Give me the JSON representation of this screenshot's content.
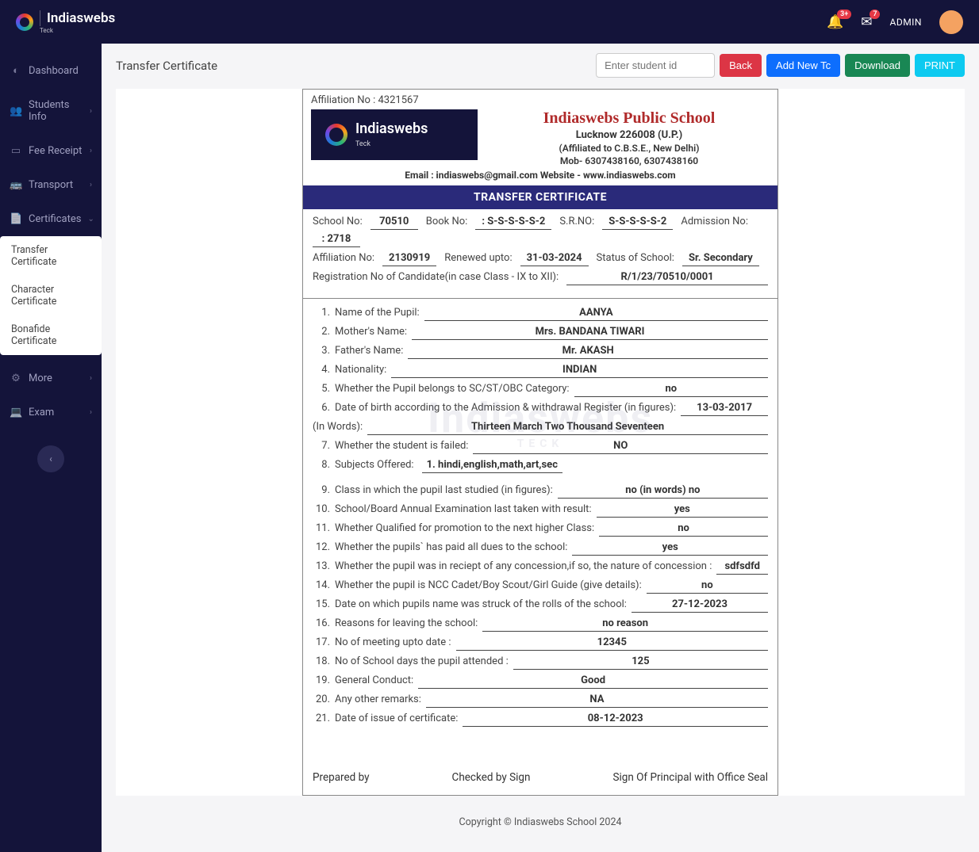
{
  "brand": {
    "name": "Indiaswebs",
    "sub": "Teck"
  },
  "topbar": {
    "notif_badge": "3+",
    "mail_badge": "7",
    "user": "ADMIN"
  },
  "sidebar": {
    "items": [
      {
        "label": "Dashboard",
        "icon": "◐"
      },
      {
        "label": "Students Info",
        "icon": "👥",
        "expand": true
      },
      {
        "label": "Fee Receipt",
        "icon": "▭",
        "expand": true
      },
      {
        "label": "Transport",
        "icon": "🚌",
        "expand": true
      },
      {
        "label": "Certificates",
        "icon": "📄",
        "expand": true
      },
      {
        "label": "More",
        "icon": "⚙",
        "expand": true
      },
      {
        "label": "Exam",
        "icon": "💻",
        "expand": true
      }
    ],
    "submenu": [
      "Transfer Certificate",
      "Character Certificate",
      "Bonafide Certificate"
    ]
  },
  "page": {
    "title": "Transfer Certificate",
    "search_placeholder": "Enter student id",
    "buttons": {
      "back": "Back",
      "add": "Add New Tc",
      "download": "Download",
      "print": "PRINT"
    }
  },
  "cert": {
    "affiliation_top": "Affiliation No : 4321567",
    "school_name": "Indiaswebs Public School",
    "school_sub": "Lucknow 226008 (U.P.)",
    "affiliated": "(Affiliated to C.B.S.E., New Delhi)",
    "mob": "Mob- 6307438160, 6307438160",
    "contact": "Email : indiaswebs@gmail.com Website - www.indiaswebs.com",
    "banner": "TRANSFER CERTIFICATE",
    "meta": {
      "school_no_l": "School No:",
      "school_no": "70510",
      "book_no_l": "Book No:",
      "book_no": ": S-S-S-S-S-2",
      "srno_l": "S.R.NO:",
      "srno": "S-S-S-S-S-2",
      "adm_l": "Admission No:",
      "adm": ": 2718",
      "aff_l": "Affiliation No:",
      "aff": "2130919",
      "renew_l": "Renewed upto:",
      "renew": "31-03-2024",
      "status_l": "Status of School:",
      "status": "Sr. Secondary",
      "reg_l": "Registration No of Candidate(in case Class - IX to XII):",
      "reg": "R/1/23/70510/0001"
    },
    "fields": [
      {
        "n": "1.",
        "l": "Name of the Pupil:",
        "v": "AANYA"
      },
      {
        "n": "2.",
        "l": "Mother's Name:",
        "v": "Mrs. BANDANA TIWARI"
      },
      {
        "n": "3.",
        "l": "Father's Name:",
        "v": "Mr. AKASH"
      },
      {
        "n": "4.",
        "l": "Nationality:",
        "v": "INDIAN"
      },
      {
        "n": "5.",
        "l": "Whether the Pupil belongs to SC/ST/OBC Category:",
        "v": "no"
      },
      {
        "n": "6.",
        "l": "Date of birth according to the Admission & withdrawal Register (in figures):",
        "v": "13-03-2017"
      }
    ],
    "in_words_l": "(In Words):",
    "in_words": "Thirteen March Two Thousand Seventeen",
    "fields2": [
      {
        "n": "7.",
        "l": "Whether the student is failed:",
        "v": "NO"
      }
    ],
    "subjects_n": "8.",
    "subjects_l": "Subjects Offered:",
    "subjects_v": "1. hindi,english,math,art,sec",
    "fields3": [
      {
        "n": "9.",
        "l": "Class in which the pupil last studied (in figures):",
        "v": "no (in words) no"
      },
      {
        "n": "10.",
        "l": "School/Board Annual Examination last taken with result:",
        "v": "yes"
      },
      {
        "n": "11.",
        "l": "Whether Qualified for promotion to the next higher Class:",
        "v": "no"
      },
      {
        "n": "12.",
        "l": "Whether the pupils` has paid all dues to the school:",
        "v": "yes"
      },
      {
        "n": "13.",
        "l": "Whether the pupil was in reciept of any concession,if so, the nature of concession :",
        "v": "sdfsdfd"
      },
      {
        "n": "14.",
        "l": "Whether the pupil is NCC Cadet/Boy Scout/Girl Guide (give details):",
        "v": "no"
      },
      {
        "n": "15.",
        "l": "Date on which pupils name was struck of the rolls of the school:",
        "v": "27-12-2023"
      },
      {
        "n": "16.",
        "l": "Reasons for leaving the school:",
        "v": "no reason"
      },
      {
        "n": "17.",
        "l": "No of meeting upto date :",
        "v": "12345"
      },
      {
        "n": "18.",
        "l": "No of School days the pupil attended :",
        "v": "125"
      },
      {
        "n": "19.",
        "l": "General Conduct:",
        "v": "Good"
      },
      {
        "n": "20.",
        "l": "Any other remarks:",
        "v": "NA"
      },
      {
        "n": "21.",
        "l": "Date of issue of certificate:",
        "v": "08-12-2023"
      }
    ],
    "signs": {
      "prep": "Prepared by",
      "check": "Checked by Sign",
      "principal": "Sign Of Principal with Office Seal"
    },
    "watermark": "Indiaswebs",
    "watermark_sub": "TECK"
  },
  "footer": "Copyright © Indiaswebs School 2024"
}
